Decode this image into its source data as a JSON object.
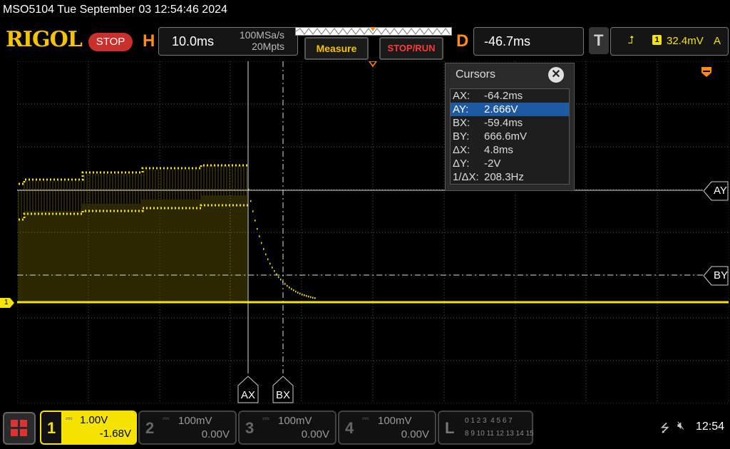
{
  "status_line": "MSO5104  Tue September 03 12:54:46 2024",
  "logo": "RIGOL",
  "run_state": "STOP",
  "horizontal": {
    "letter": "H",
    "timebase": "10.0ms",
    "sample_rate": "100MSa/s",
    "memory_depth": "20Mpts"
  },
  "buttons": {
    "measure": "Measure",
    "stop_run": "STOP/RUN"
  },
  "delay": {
    "letter": "D",
    "value": "-46.7ms"
  },
  "trigger": {
    "letter": "T",
    "source": "1",
    "level": "32.4mV",
    "mode": "A"
  },
  "cursors": {
    "title": "Cursors",
    "rows": [
      {
        "key": "AX:",
        "value": "-64.2ms"
      },
      {
        "key": "AY:",
        "value": "2.666V"
      },
      {
        "key": "BX:",
        "value": "-59.4ms"
      },
      {
        "key": "BY:",
        "value": "666.6mV"
      },
      {
        "key": "ΔX:",
        "value": "4.8ms"
      },
      {
        "key": "ΔY:",
        "value": "-2V"
      },
      {
        "key": "1/ΔX:",
        "value": "208.3Hz"
      }
    ],
    "selected_row": 1
  },
  "cursor_labels": {
    "ax": "AX",
    "bx": "BX",
    "ay": "AY",
    "by": "BY"
  },
  "ch_marker": "1",
  "channels": [
    {
      "num": "1",
      "scale": "1.00V",
      "offset": "-1.68V",
      "active": true
    },
    {
      "num": "2",
      "scale": "100mV",
      "offset": "0.00V",
      "active": false
    },
    {
      "num": "3",
      "scale": "100mV",
      "offset": "0.00V",
      "active": false
    },
    {
      "num": "4",
      "scale": "100mV",
      "offset": "0.00V",
      "active": false
    }
  ],
  "logic": {
    "letter": "L",
    "row1": "0 1 2 3  4 5 6 7",
    "row2": "8 9 10 11 12 13 14 15"
  },
  "clock": "12:54",
  "colors": {
    "ch1": "#f5e400",
    "accent": "#ff8c1a",
    "selected": "#1e5aa3"
  }
}
